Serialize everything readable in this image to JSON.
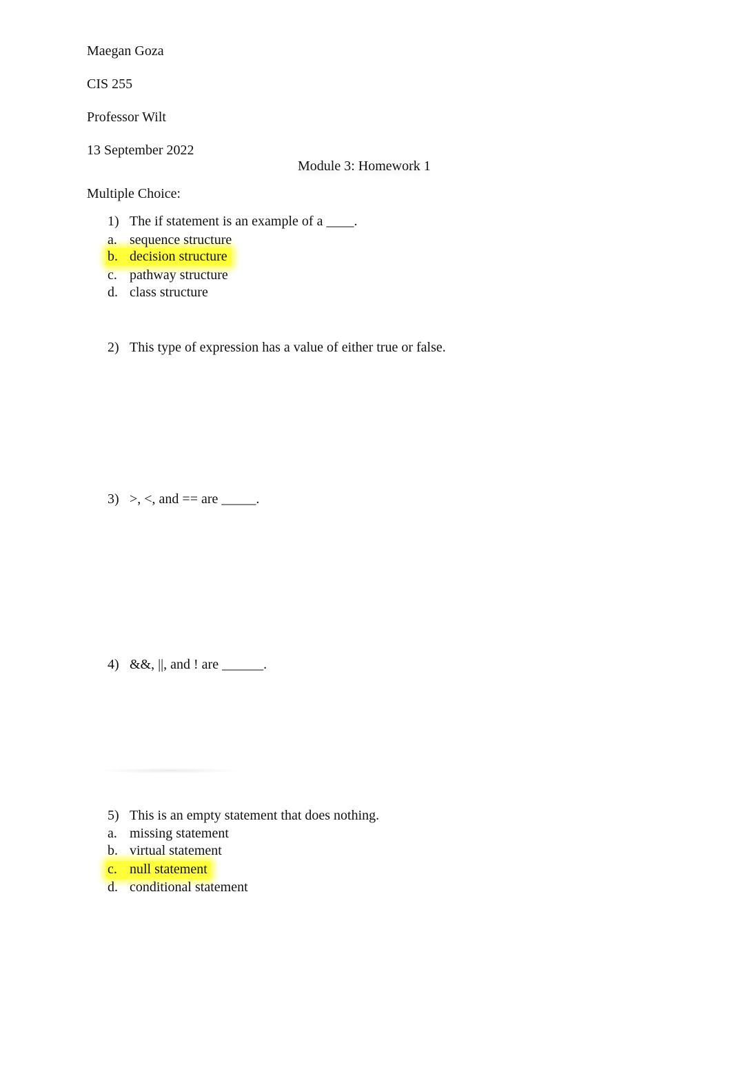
{
  "header": {
    "student_name": "Maegan Goza",
    "course": "CIS 255",
    "professor": "Professor Wilt",
    "date": "13 September 2022"
  },
  "title": "Module 3: Homework 1",
  "section_label": "Multiple Choice:",
  "highlight_color": "#ffff3a",
  "questions": [
    {
      "number": "1)",
      "text": "The if statement is an example of a ____.",
      "options": [
        {
          "letter": "a.",
          "text": "sequence structure",
          "highlighted": false
        },
        {
          "letter": "b.",
          "text": "decision structure",
          "highlighted": true
        },
        {
          "letter": "c.",
          "text": "pathway structure",
          "highlighted": false
        },
        {
          "letter": "d.",
          "text": "class structure",
          "highlighted": false
        }
      ]
    },
    {
      "number": "2)",
      "text": "This type of expression has a value of either true or false.",
      "options": []
    },
    {
      "number": "3)",
      "text": ">, <, and == are _____.",
      "options": []
    },
    {
      "number": "4)",
      "text": "&&, ||, and ! are ______.",
      "options": []
    },
    {
      "number": "5)",
      "text": "This is an empty statement that does nothing.",
      "options": [
        {
          "letter": "a.",
          "text": "missing statement",
          "highlighted": false
        },
        {
          "letter": "b.",
          "text": "virtual statement",
          "highlighted": false
        },
        {
          "letter": "c.",
          "text": "null statement",
          "highlighted": true
        },
        {
          "letter": "d.",
          "text": "conditional statement",
          "highlighted": false
        }
      ]
    }
  ]
}
